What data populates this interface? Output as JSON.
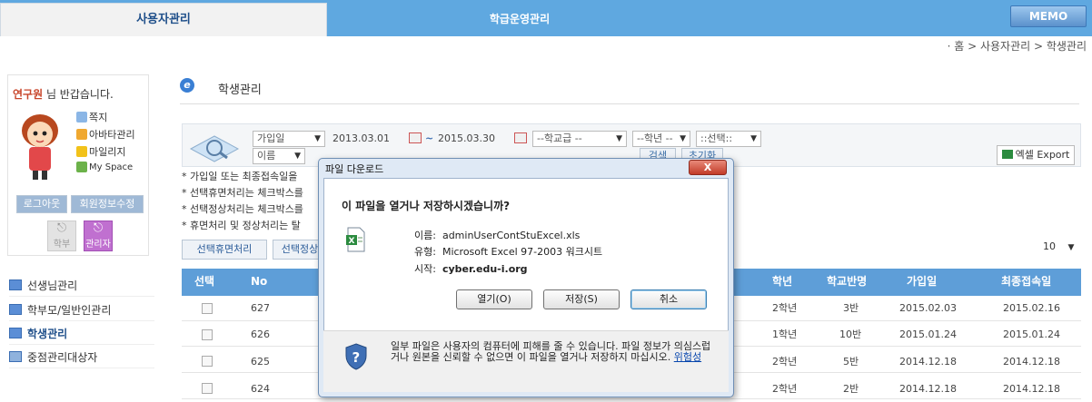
{
  "tabs": {
    "user": "사용자관리",
    "course": "학급운영관리",
    "memo": "MEMO"
  },
  "breadcrumb": "· 홈 > 사용자관리 > 학생관리",
  "left": {
    "welcome_name": "연구원",
    "welcome_suffix": " 님 반갑습니다.",
    "quick": [
      "쪽지",
      "아바타관리",
      "마일리지",
      "My Space"
    ],
    "logout": "로그아웃",
    "edit_info": "회원정보수정",
    "role_parent": "학부",
    "role_admin": "관리자",
    "nav": [
      "선생님관리",
      "학부모/일반인관리",
      "학생관리",
      "중점관리대상자"
    ]
  },
  "page_title": "학생관리",
  "filter": {
    "date_type": "가입일",
    "name_type": "이름",
    "date_from": "2013.03.01",
    "tilde": "~",
    "date_to": "2015.03.30",
    "school": "--학교급 --",
    "grade": "--학년 --",
    "choose": "::선택::",
    "search": "검색",
    "reset": "초기화",
    "excel": "엑셀 Export"
  },
  "notes": [
    "* 가입일 또는 최종접속일을",
    "* 선택휴면처리는 체크박스를",
    "* 선택정상처리는 체크박스를",
    "* 휴면처리 및 정상처리는 탈"
  ],
  "actions": {
    "dormant": "선택휴면처리",
    "normal": "선택정상"
  },
  "page_size": "10",
  "table": {
    "headers": {
      "select": "선택",
      "no": "No",
      "grade": "학년",
      "class": "학교반명",
      "joined": "가입일",
      "last": "최종접속일"
    },
    "rows": [
      {
        "no": "627",
        "grade": "2학년",
        "class": "3반",
        "joined": "2015.02.03",
        "last": "2015.02.16"
      },
      {
        "no": "626",
        "grade": "1학년",
        "class": "10반",
        "joined": "2015.01.24",
        "last": "2015.01.24"
      },
      {
        "no": "625",
        "grade": "2학년",
        "class": "5반",
        "joined": "2014.12.18",
        "last": "2014.12.18"
      },
      {
        "no": "624",
        "grade": "2학년",
        "class": "2반",
        "joined": "2014.12.18",
        "last": "2014.12.18"
      }
    ]
  },
  "dialog": {
    "title": "파일 다운로드",
    "question": "이 파일을 열거나 저장하시겠습니까?",
    "name_label": "이름:",
    "name_value": "adminUserContStuExcel.xls",
    "type_label": "유형:",
    "type_value": "Microsoft Excel 97-2003 워크시트",
    "from_label": "시작:",
    "from_value": "cyber.edu-i.org",
    "open": "열기(O)",
    "save": "저장(S)",
    "cancel": "취소",
    "warning": "일부 파일은 사용자의 컴퓨터에 피해를 줄 수 있습니다. 파일 정보가 의심스럽거나 원본을 신뢰할 수 없으면 이 파일을 열거나 저장하지 마십시오.",
    "risk_link": "위험성",
    "close": "X"
  }
}
